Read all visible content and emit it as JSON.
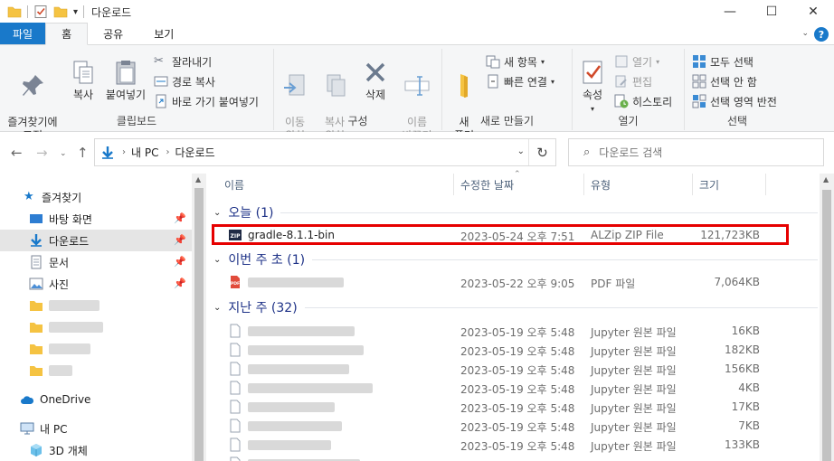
{
  "window": {
    "title": "다운로드"
  },
  "ribbon_tabs": [
    "파일",
    "홈",
    "공유",
    "보기"
  ],
  "clipboard": {
    "pin": "즐겨찾기에\n고정",
    "copy": "복사",
    "paste": "붙여넣기",
    "cut": "잘라내기",
    "copy_path": "경로 복사",
    "paste_shortcut": "바로 가기 붙여넣기",
    "label": "클립보드"
  },
  "organize": {
    "move_to": "이동\n위치",
    "copy_to": "복사\n위치",
    "delete": "삭제",
    "rename": "이름\n바꾸기",
    "label": "구성"
  },
  "new": {
    "new_folder": "새\n폴더",
    "new_item": "새 항목",
    "easy_access": "빠른 연결",
    "label": "새로 만들기"
  },
  "open": {
    "properties": "속성",
    "open": "열기",
    "edit": "편집",
    "history": "히스토리",
    "label": "열기"
  },
  "select": {
    "select_all": "모두 선택",
    "select_none": "선택 안 함",
    "invert": "선택 영역 반전",
    "label": "선택"
  },
  "address": {
    "root": "내 PC",
    "current": "다운로드"
  },
  "search": {
    "placeholder": "다운로드 검색"
  },
  "nav_pane": {
    "quick_access": "즐겨찾기",
    "desktop": "바탕 화면",
    "downloads": "다운로드",
    "documents": "문서",
    "pictures": "사진",
    "onedrive": "OneDrive",
    "this_pc": "내 PC",
    "objects3d": "3D 개체"
  },
  "columns": {
    "name": "이름",
    "date": "수정한 날짜",
    "type": "유형",
    "size": "크기"
  },
  "groups": {
    "today": "오늘 (1)",
    "this_week": "이번 주 초 (1)",
    "last_week": "지난 주 (32)"
  },
  "files": {
    "today": [
      {
        "name": "gradle-8.1.1-bin",
        "date": "2023-05-24 오후 7:51",
        "type": "ALZip ZIP File",
        "size": "121,723KB"
      }
    ],
    "this_week": [
      {
        "date": "2023-05-22 오후 9:05",
        "type": "PDF 파일",
        "size": "7,064KB"
      }
    ],
    "last_week": [
      {
        "date": "2023-05-19 오후 5:48",
        "type": "Jupyter 원본 파일",
        "size": "16KB"
      },
      {
        "date": "2023-05-19 오후 5:48",
        "type": "Jupyter 원본 파일",
        "size": "182KB"
      },
      {
        "date": "2023-05-19 오후 5:48",
        "type": "Jupyter 원본 파일",
        "size": "156KB"
      },
      {
        "date": "2023-05-19 오후 5:48",
        "type": "Jupyter 원본 파일",
        "size": "4KB"
      },
      {
        "date": "2023-05-19 오후 5:48",
        "type": "Jupyter 원본 파일",
        "size": "17KB"
      },
      {
        "date": "2023-05-19 오후 5:48",
        "type": "Jupyter 원본 파일",
        "size": "7KB"
      },
      {
        "date": "2023-05-19 오후 5:48",
        "type": "Jupyter 원본 파일",
        "size": "133KB"
      }
    ]
  },
  "colors": {
    "accent": "#1979ca",
    "group_header": "#1e3287",
    "highlight": "#e60000",
    "folder": "#f5c342"
  }
}
